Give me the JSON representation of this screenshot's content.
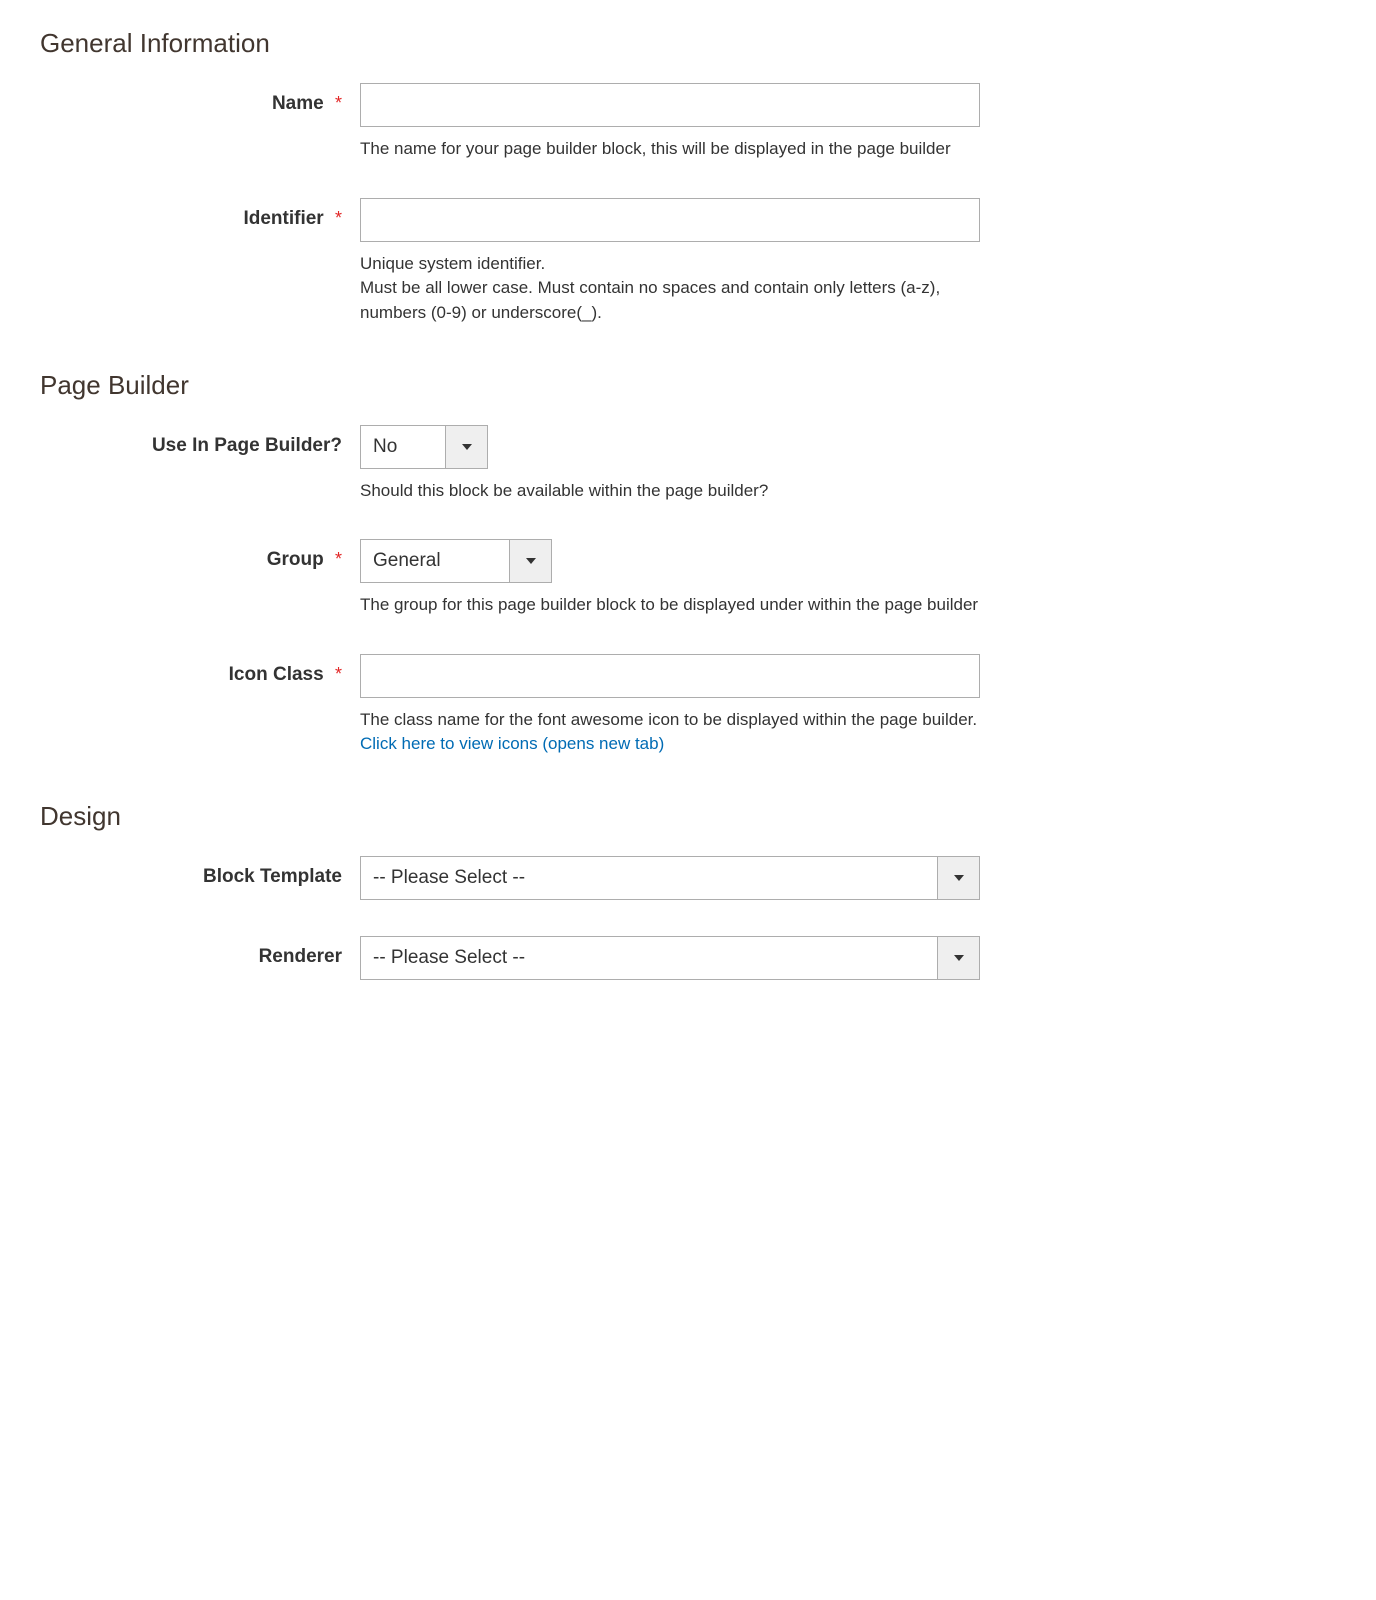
{
  "sections": {
    "general": {
      "heading": "General Information",
      "name": {
        "label": "Name",
        "required": "*",
        "value": "",
        "help": "The name for your page builder block, this will be displayed in the page builder"
      },
      "identifier": {
        "label": "Identifier",
        "required": "*",
        "value": "",
        "help": "Unique system identifier.\nMust be all lower case. Must contain no spaces and contain only letters (a-z), numbers (0-9) or underscore(_)."
      }
    },
    "page_builder": {
      "heading": "Page Builder",
      "use_in_pb": {
        "label": "Use In Page Builder?",
        "value": "No",
        "help": "Should this block be available within the page builder?"
      },
      "group": {
        "label": "Group",
        "required": "*",
        "value": "General",
        "help": "The group for this page builder block to be displayed under within the page builder"
      },
      "icon_class": {
        "label": "Icon Class",
        "required": "*",
        "value": "",
        "help": "The class name for the font awesome icon to be displayed within the page builder.",
        "link_text": "Click here to view icons (opens new tab)"
      }
    },
    "design": {
      "heading": "Design",
      "block_template": {
        "label": "Block Template",
        "value": "-- Please Select --"
      },
      "renderer": {
        "label": "Renderer",
        "value": "-- Please Select --"
      }
    }
  }
}
